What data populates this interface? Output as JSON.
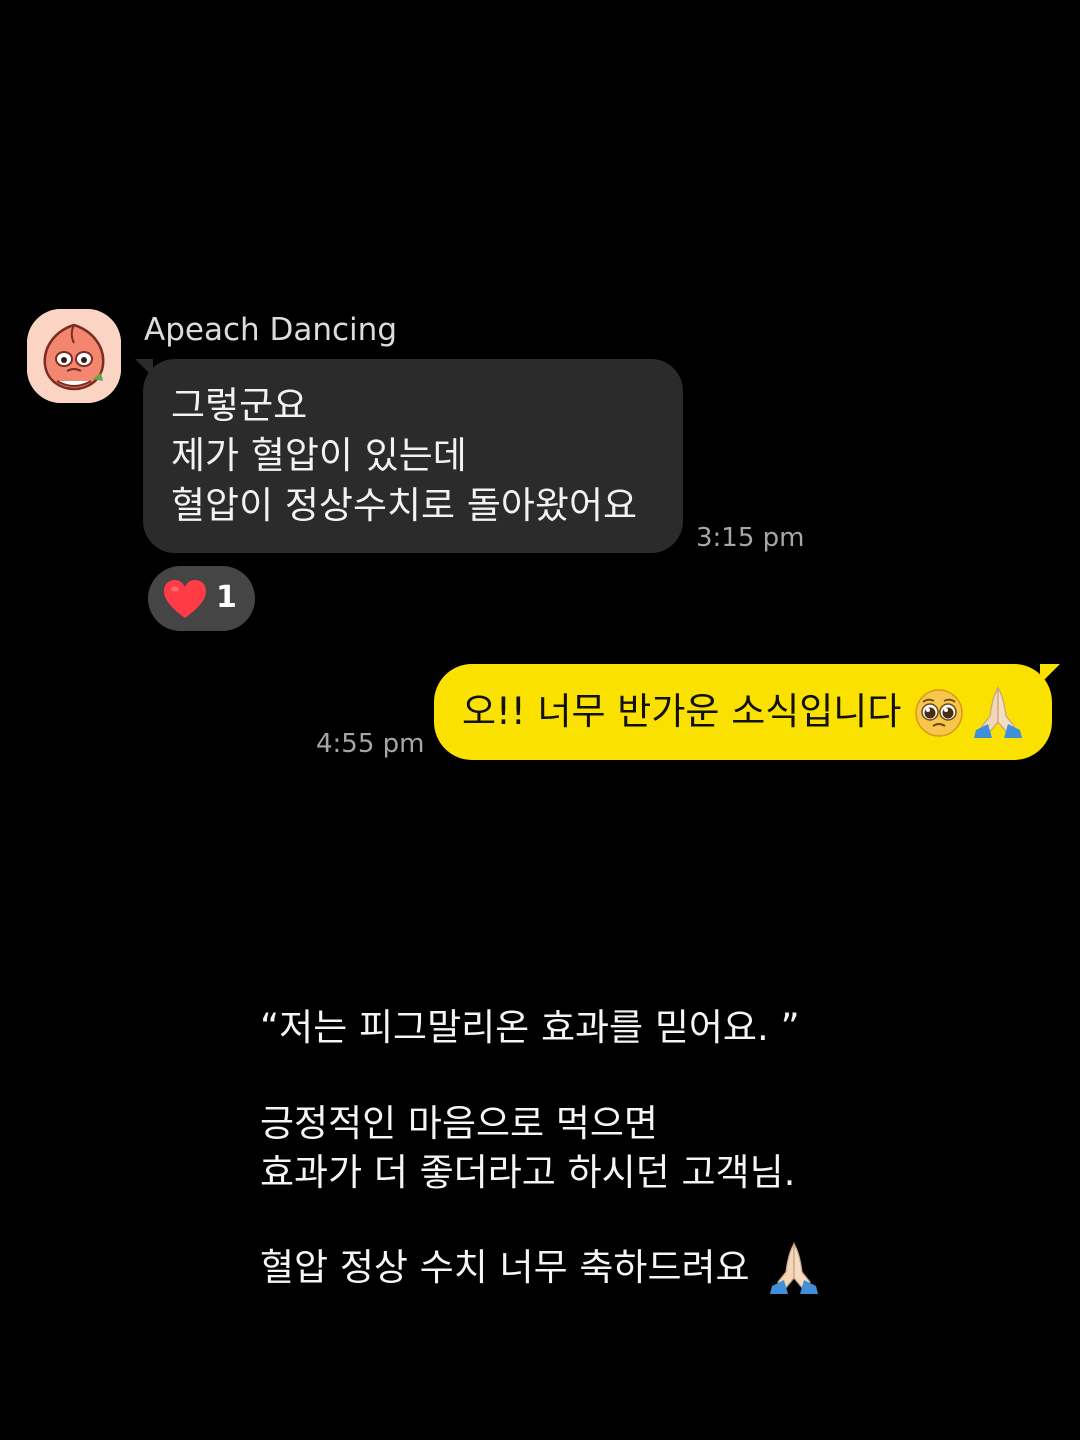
{
  "incoming": {
    "sender_name": "Apeach Dancing",
    "avatar_icon": "apeach-peach-character-icon",
    "lines": [
      "그렇군요",
      "제가 혈압이 있는데",
      "혈압이 정상수치로 돌아왔어요"
    ],
    "time": "3:15 pm",
    "reaction": {
      "icon": "red-heart-icon",
      "count": "1"
    },
    "bubble_color": "#2b2b2b"
  },
  "outgoing": {
    "text": "오!! 너무 반가운 소식입니다",
    "emojis": [
      "pleading-face-icon",
      "folded-hands-icon"
    ],
    "time": "4:55 pm",
    "bubble_color": "#fae100"
  },
  "caption": {
    "quote": "“저는 피그말리온 효과를 믿어요. ”",
    "paragraph_lines": [
      "긍정적인 마음으로 먹으면",
      "효과가 더 좋더라고 하시던 고객님."
    ],
    "closing": "혈압 정상 수치 너무 축하드려요",
    "closing_emoji": "folded-hands-icon"
  },
  "colors": {
    "background": "#000000",
    "heart": "#ff3b45"
  }
}
